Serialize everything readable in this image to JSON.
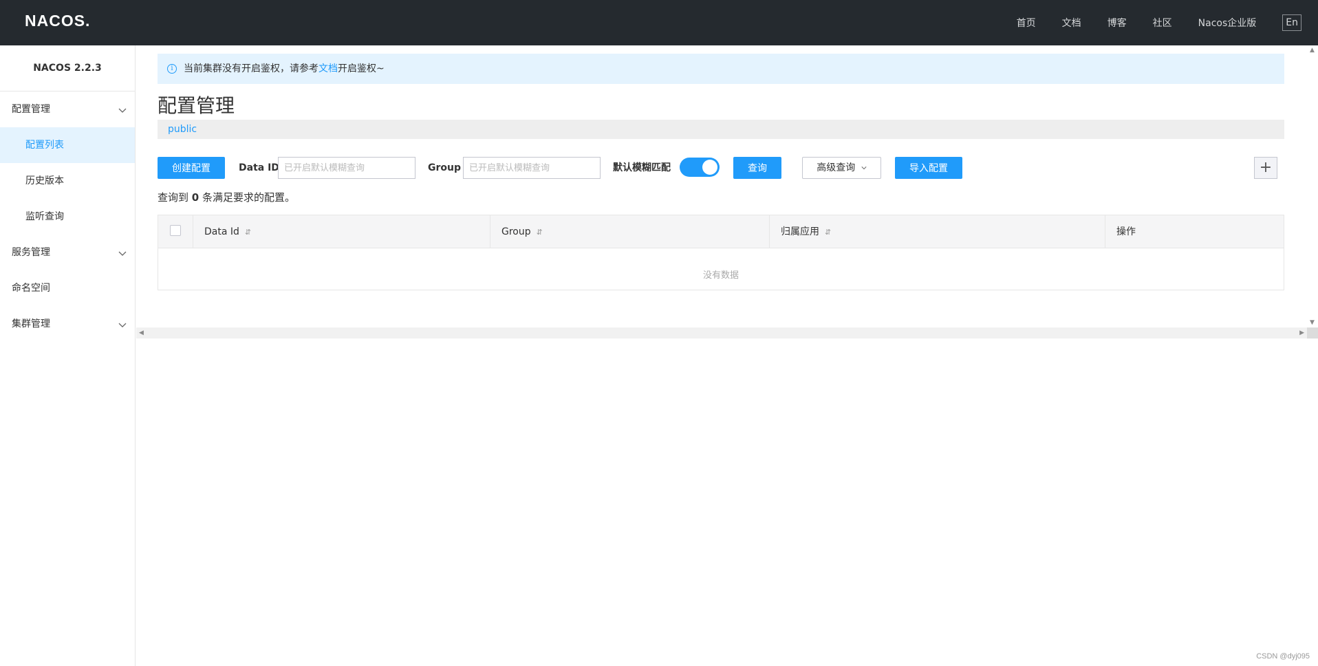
{
  "header": {
    "logo": "NACOS.",
    "nav": [
      "首页",
      "文档",
      "博客",
      "社区",
      "Nacos企业版"
    ],
    "lang": "En"
  },
  "sidebar": {
    "title": "NACOS 2.2.3",
    "groups": [
      {
        "label": "配置管理",
        "items": [
          "配置列表",
          "历史版本",
          "监听查询"
        ]
      },
      {
        "label": "服务管理"
      },
      {
        "label": "命名空间"
      },
      {
        "label": "集群管理"
      }
    ],
    "active_item": "配置列表"
  },
  "notice": {
    "before": "当前集群没有开启鉴权，请参考",
    "link": "文档",
    "after": "开启鉴权~"
  },
  "page_title": "配置管理",
  "namespace": "public",
  "toolbar": {
    "create_label": "创建配置",
    "dataid_label": "Data ID",
    "dataid_placeholder": "已开启默认模糊查询",
    "group_label": "Group",
    "group_placeholder": "已开启默认模糊查询",
    "fuzzy_label": "默认模糊匹配",
    "fuzzy_on": true,
    "query_label": "查询",
    "advanced_label": "高级查询",
    "import_label": "导入配置",
    "plus_label": "+"
  },
  "result": {
    "prefix": "查询到",
    "count": "0",
    "suffix": "条满足要求的配置。"
  },
  "table": {
    "columns": [
      "Data Id",
      "Group",
      "归属应用",
      "操作"
    ],
    "empty_text": "没有数据"
  },
  "watermark": "CSDN @dyj095",
  "colors": {
    "topbar": "#252a2f",
    "primary": "#209bfa",
    "notice_bg": "#e4f3fe"
  }
}
